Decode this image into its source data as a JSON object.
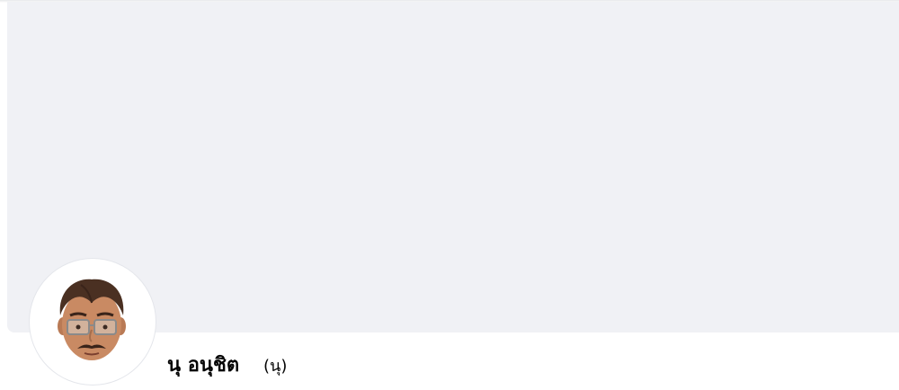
{
  "profile": {
    "name": "นุ อนุชิต",
    "nickname": "(นุ)"
  },
  "icons": {
    "avatar": "memoji-avatar-icon"
  },
  "colors": {
    "cover_background": "#f0f1f5",
    "page_background": "#ffffff",
    "text": "#050505"
  }
}
